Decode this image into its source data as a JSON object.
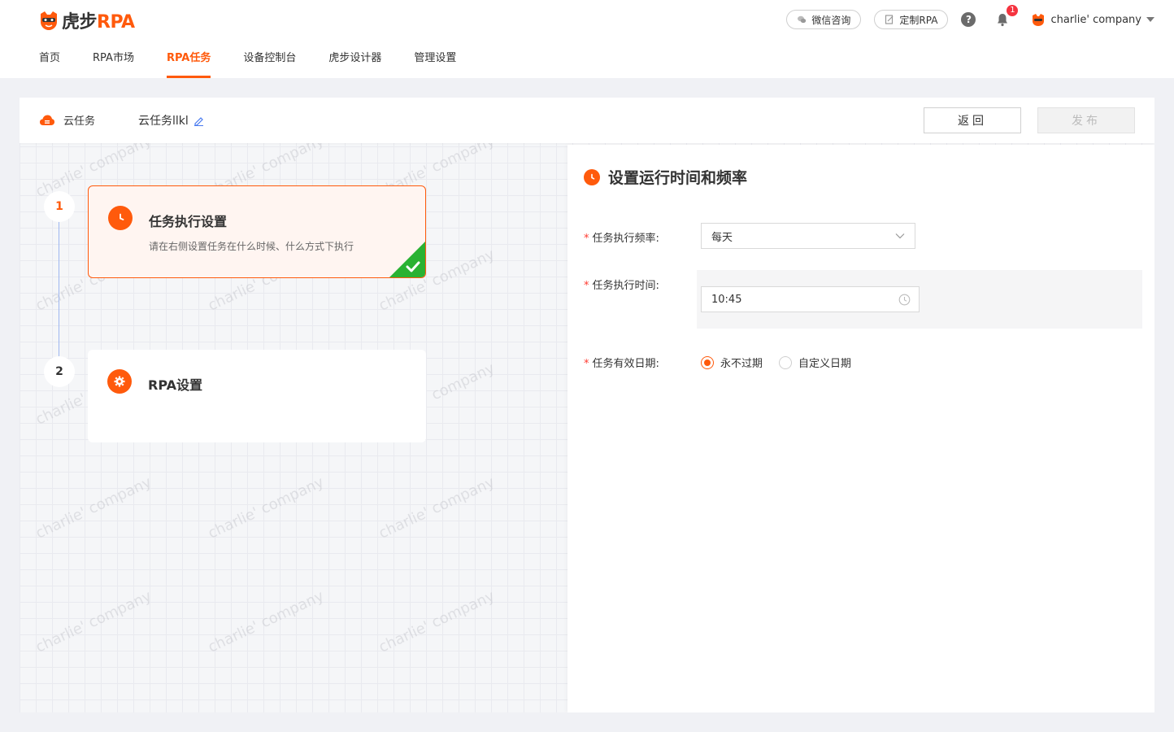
{
  "brand": {
    "logo_text_cn": "虎步",
    "logo_text_en": "RPA"
  },
  "top": {
    "wechat_label": "微信咨询",
    "custom_label": "定制RPA",
    "help_symbol": "?",
    "notification_count": "1",
    "user_name": "charlie' company"
  },
  "nav": {
    "items": [
      {
        "label": "首页",
        "active": false
      },
      {
        "label": "RPA市场",
        "active": false
      },
      {
        "label": "RPA任务",
        "active": true
      },
      {
        "label": "设备控制台",
        "active": false
      },
      {
        "label": "虎步设计器",
        "active": false
      },
      {
        "label": "管理设置",
        "active": false
      }
    ]
  },
  "subhead": {
    "cloud_label": "云任务",
    "task_name": "云任务llkl",
    "back_label": "返回",
    "publish_label": "发布"
  },
  "steps": [
    {
      "num": "1",
      "title": "任务执行设置",
      "desc": "请在右侧设置任务在什么时候、什么方式下执行"
    },
    {
      "num": "2",
      "title": "RPA设置",
      "desc": ""
    }
  ],
  "panel": {
    "title": "设置运行时间和频率",
    "frequency_label": "任务执行频率:",
    "frequency_value": "每天",
    "time_label": "任务执行时间:",
    "time_value": "10:45",
    "validity_label": "任务有效日期:",
    "radio_never": "永不过期",
    "radio_custom": "自定义日期"
  },
  "watermark_text": "charlie' company",
  "colors": {
    "accent": "#ff5a0c",
    "line": "#9db6f0",
    "badge": "#f5333f"
  }
}
